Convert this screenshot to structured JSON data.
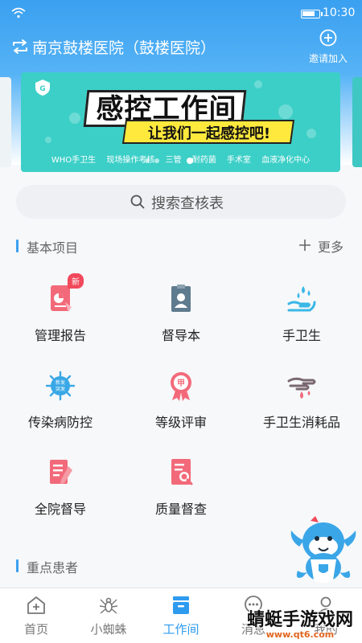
{
  "status_bar": {
    "time": "10:30",
    "wifi_icon": "wifi-icon",
    "battery_icon": "battery-icon"
  },
  "header": {
    "title": "南京鼓楼医院（鼓楼医院）",
    "switch_icon": "switch-arrows-icon",
    "invite_label": "邀请加入",
    "invite_icon": "plus-circle-icon"
  },
  "banner": {
    "title": "感控工作间",
    "subtitle": "让我们一起感控吧!",
    "tags": [
      "WHO手卫生",
      "现场操作考核",
      "三管",
      "耐药菌",
      "手术室",
      "血液净化中心"
    ],
    "slide_count": 3,
    "active_slide": 2
  },
  "search": {
    "label": "搜索查核表",
    "icon": "search-icon"
  },
  "basic_section": {
    "title": "基本项目",
    "more_label": "更多",
    "items": [
      {
        "label": "管理报告",
        "icon": "report-icon",
        "badge": "新"
      },
      {
        "label": "督导本",
        "icon": "supervision-book-icon"
      },
      {
        "label": "手卫生",
        "icon": "hand-hygiene-icon"
      },
      {
        "label": "传染病防控",
        "icon": "infection-control-icon"
      },
      {
        "label": "等级评审",
        "icon": "grade-review-icon"
      },
      {
        "label": "手卫生消耗品",
        "icon": "hand-consumables-icon"
      },
      {
        "label": "全院督导",
        "icon": "hospital-supervision-icon"
      },
      {
        "label": "质量督查",
        "icon": "quality-check-icon"
      }
    ]
  },
  "key_section": {
    "title": "重点患者"
  },
  "bottom_nav": [
    {
      "label": "首页",
      "icon": "home-icon"
    },
    {
      "label": "小蜘蛛",
      "icon": "spider-icon"
    },
    {
      "label": "工作间",
      "icon": "workspace-icon",
      "active": true
    },
    {
      "label": "消息",
      "icon": "message-icon"
    },
    {
      "label": "我的",
      "icon": "profile-icon"
    }
  ],
  "watermark": {
    "text": "蜻蜓手游戏网",
    "url": "www.qt6.com"
  },
  "colors": {
    "primary": "#2e9bef",
    "banner": "#3ccfc7",
    "accent_red": "#f1495b"
  }
}
